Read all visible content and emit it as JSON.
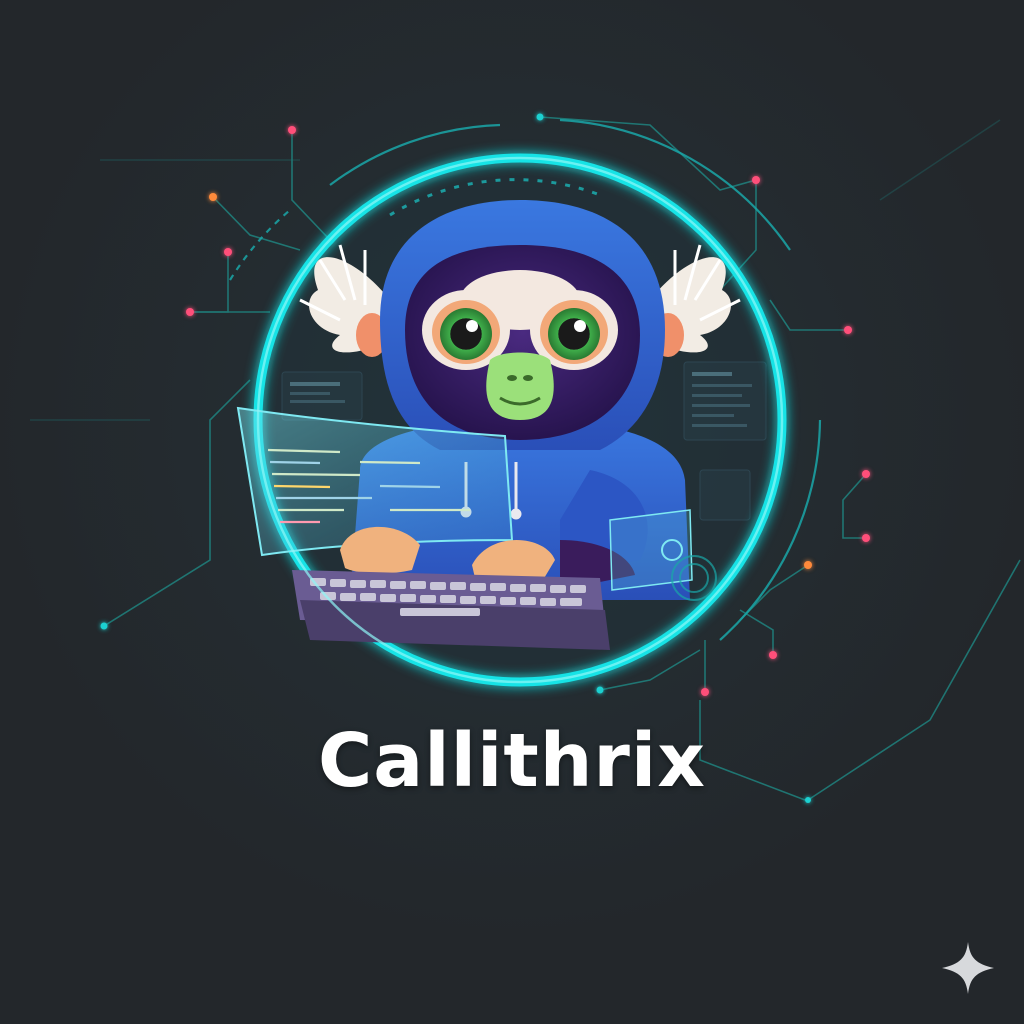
{
  "brand": {
    "name": "Callithrix"
  },
  "colors": {
    "background": "#23272b",
    "ring": "#19e3e6",
    "circuit": "#1f8f8a",
    "node_pink": "#ff4f7a",
    "node_orange": "#ff8a3a",
    "hoodie": "#2f5fd0",
    "face_fur": "#3b1f6b",
    "muzzle": "#9be07a",
    "ear_tuft": "#f2ece4",
    "keyboard": "#4a3f6a"
  },
  "icons": {
    "mascot": "marmoset-hacker-illustration",
    "sparkle": "sparkle-icon"
  }
}
